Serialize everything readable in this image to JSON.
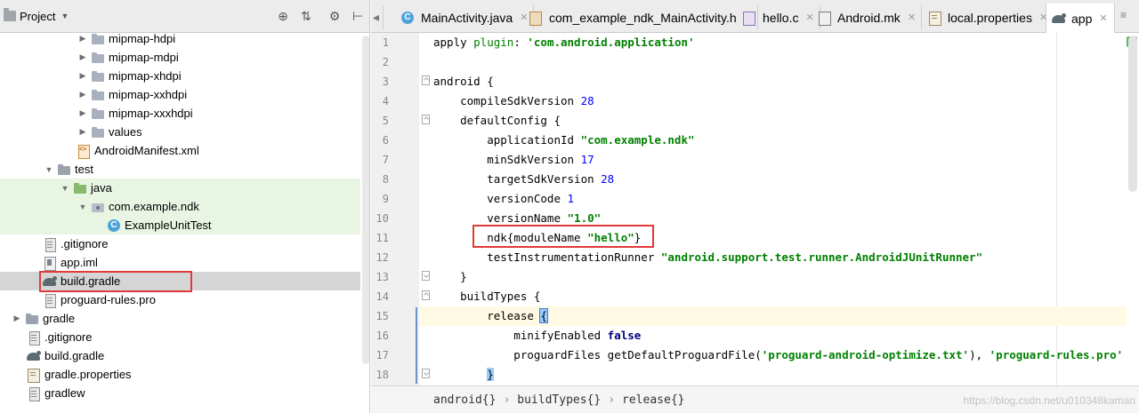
{
  "project_panel": {
    "title": "Project",
    "tree": [
      {
        "label": "mipmap-hdpi",
        "kind": "folder-res",
        "expanded": false
      },
      {
        "label": "mipmap-mdpi",
        "kind": "folder-res",
        "expanded": false
      },
      {
        "label": "mipmap-xhdpi",
        "kind": "folder-res",
        "expanded": false
      },
      {
        "label": "mipmap-xxhdpi",
        "kind": "folder-res",
        "expanded": false
      },
      {
        "label": "mipmap-xxxhdpi",
        "kind": "folder-res",
        "expanded": false
      },
      {
        "label": "values",
        "kind": "folder-res",
        "expanded": false
      },
      {
        "label": "AndroidManifest.xml",
        "kind": "xml"
      },
      {
        "label": "test",
        "kind": "folder",
        "expanded": true
      },
      {
        "label": "java",
        "kind": "folder-src",
        "expanded": true
      },
      {
        "label": "com.example.ndk",
        "kind": "package",
        "expanded": true
      },
      {
        "label": "ExampleUnitTest",
        "kind": "class"
      },
      {
        "label": ".gitignore",
        "kind": "file"
      },
      {
        "label": "app.iml",
        "kind": "iml"
      },
      {
        "label": "build.gradle",
        "kind": "gradle",
        "selected": true
      },
      {
        "label": "proguard-rules.pro",
        "kind": "file"
      },
      {
        "label": "gradle",
        "kind": "folder",
        "expanded": false
      },
      {
        "label": ".gitignore",
        "kind": "file"
      },
      {
        "label": "build.gradle",
        "kind": "gradle"
      },
      {
        "label": "gradle.properties",
        "kind": "props"
      },
      {
        "label": "gradlew",
        "kind": "file"
      }
    ]
  },
  "tabs": [
    {
      "label": "MainActivity.java",
      "icon": "class-icon",
      "active": false
    },
    {
      "label": "com_example_ndk_MainActivity.h",
      "icon": "header-file-icon",
      "active": false
    },
    {
      "label": "hello.c",
      "icon": "c-file-icon",
      "active": false
    },
    {
      "label": "Android.mk",
      "icon": "makefile-icon",
      "active": false
    },
    {
      "label": "local.properties",
      "icon": "properties-icon",
      "active": false
    },
    {
      "label": "app",
      "icon": "gradle-icon",
      "active": true
    }
  ],
  "line_numbers": [
    "1",
    "2",
    "3",
    "4",
    "5",
    "6",
    "7",
    "8",
    "9",
    "10",
    "11",
    "12",
    "13",
    "14",
    "15",
    "16",
    "17",
    "18"
  ],
  "code": {
    "l1_a": "apply ",
    "l1_b": "plugin",
    "l1_c": ": ",
    "l1_d": "'com.android.application'",
    "l3": "android {",
    "l4_a": "    compileSdkVersion ",
    "l4_b": "28",
    "l5": "    defaultConfig {",
    "l6_a": "        applicationId ",
    "l6_b": "\"com.example.ndk\"",
    "l7_a": "        minSdkVersion ",
    "l7_b": "17",
    "l8_a": "        targetSdkVersion ",
    "l8_b": "28",
    "l9_a": "        versionCode ",
    "l9_b": "1",
    "l10_a": "        versionName ",
    "l10_b": "\"1.0\"",
    "l11_a": "        ndk{moduleName ",
    "l11_b": "\"hello\"",
    "l11_c": "}",
    "l12_a": "        testInstrumentationRunner ",
    "l12_b": "\"android.support.test.runner.AndroidJUnitRunner\"",
    "l13": "    }",
    "l14": "    buildTypes {",
    "l15_a": "        release ",
    "l15_b": "{",
    "l16_a": "            minifyEnabled ",
    "l16_b": "false",
    "l17_a": "            proguardFiles getDefaultProguardFile(",
    "l17_b": "'proguard-android-optimize.txt'",
    "l17_c": "), ",
    "l17_d": "'proguard-rules.pro'",
    "l18_a": "        ",
    "l18_b": "}"
  },
  "breadcrumb": [
    "android{}",
    "buildTypes{}",
    "release{}"
  ],
  "watermark": "https://blog.csdn.net/u010348kaman",
  "colors": {
    "highlight_box": "#e03a3a",
    "string": "#008000",
    "keyword": "#000080",
    "number": "#0000ff",
    "test_folder_bg": "#e9f5e3"
  }
}
